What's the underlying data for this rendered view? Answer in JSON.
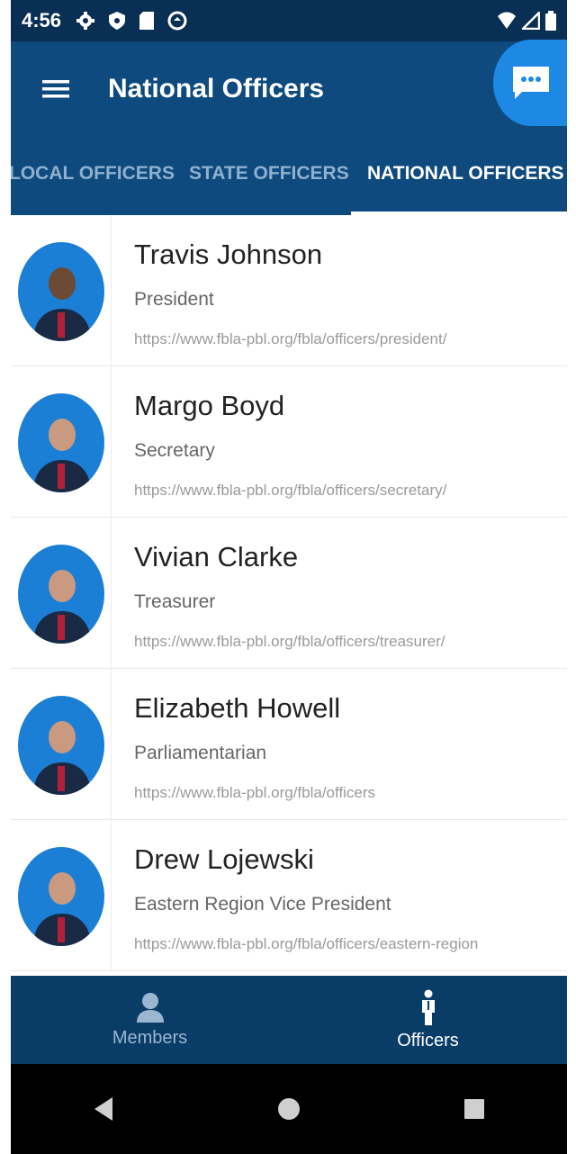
{
  "status_bar": {
    "time": "4:56"
  },
  "app_bar": {
    "title": "National Officers"
  },
  "tabs": [
    {
      "label": "LOCAL OFFICERS",
      "active": false
    },
    {
      "label": "STATE OFFICERS",
      "active": false
    },
    {
      "label": "NATIONAL OFFICERS",
      "active": true
    }
  ],
  "officers": [
    {
      "name": "Travis Johnson",
      "role": "President",
      "url": "https://www.fbla-pbl.org/fbla/officers/president/"
    },
    {
      "name": "Margo Boyd",
      "role": "Secretary",
      "url": "https://www.fbla-pbl.org/fbla/officers/secretary/"
    },
    {
      "name": "Vivian Clarke",
      "role": "Treasurer",
      "url": "https://www.fbla-pbl.org/fbla/officers/treasurer/"
    },
    {
      "name": "Elizabeth Howell",
      "role": "Parliamentarian",
      "url": "https://www.fbla-pbl.org/fbla/officers"
    },
    {
      "name": "Drew Lojewski",
      "role": "Eastern Region Vice President",
      "url": "https://www.fbla-pbl.org/fbla/officers/eastern-region"
    }
  ],
  "bottom_nav": [
    {
      "label": "Members",
      "icon": "person-icon",
      "active": false
    },
    {
      "label": "Officers",
      "icon": "officer-icon",
      "active": true
    }
  ],
  "colors": {
    "status_bar": "#0a2f55",
    "app_bar": "#0e4a7d",
    "fab": "#1e88e5",
    "bottom_nav": "#0a3c68"
  }
}
